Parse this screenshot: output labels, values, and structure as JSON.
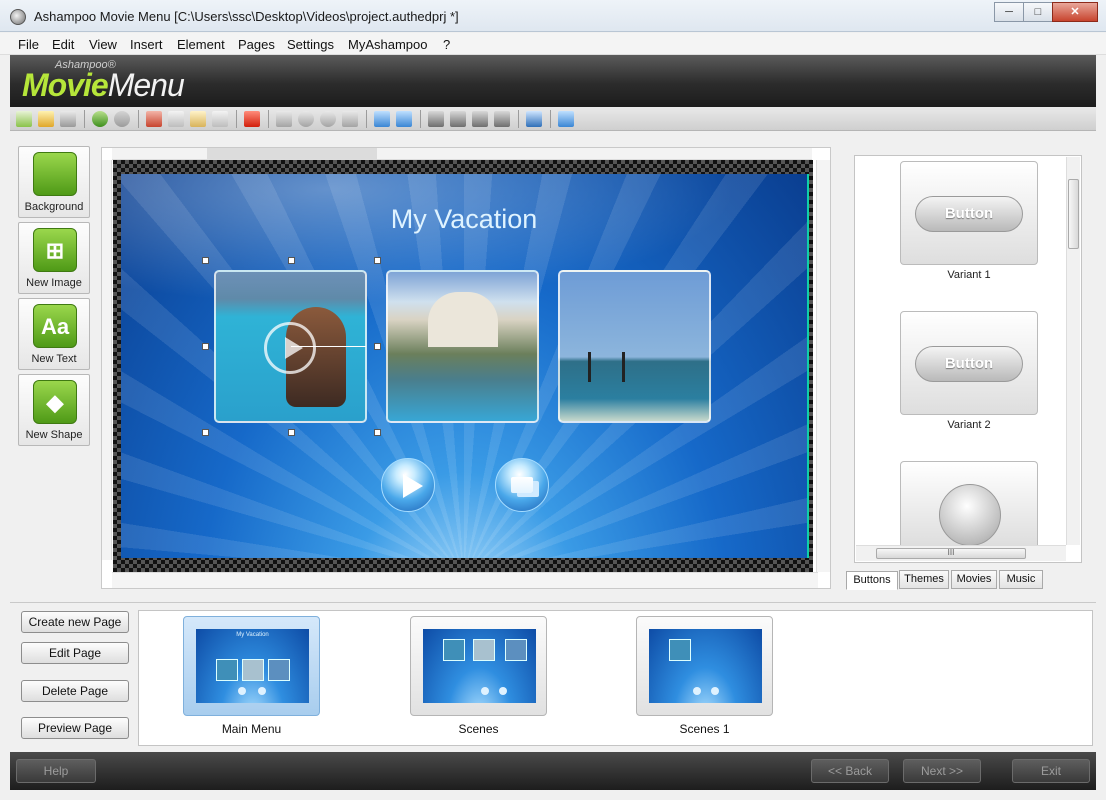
{
  "window": {
    "title": "Ashampoo Movie Menu [C:\\Users\\ssc\\Desktop\\Videos\\project.authedprj *]",
    "controls": {
      "minimize": "─",
      "maximize": "□",
      "close": "✕"
    }
  },
  "menubar": [
    "File",
    "Edit",
    "View",
    "Insert",
    "Element",
    "Pages",
    "Settings",
    "MyAshampoo",
    "?"
  ],
  "brand": {
    "small": "Ashampoo®",
    "movie": "Movie",
    "menu": "Menu"
  },
  "toolbar": {
    "icons": [
      "new-icon",
      "open-icon",
      "save-icon",
      "undo-icon",
      "redo-icon",
      "cut-icon",
      "copy-icon",
      "paste-icon",
      "paste-special-icon",
      "delete-icon",
      "zoom-fit-icon",
      "zoom-in-icon",
      "zoom-out-icon",
      "zoom-actual-icon",
      "bring-front-icon",
      "send-back-icon",
      "flip-horizontal-icon",
      "flip-vertical-icon",
      "align-center-vertical-icon",
      "align-center-horizontal-icon",
      "properties-icon",
      "preview-icon"
    ]
  },
  "palette": {
    "items": [
      {
        "label": "Background",
        "icon": "background-icon"
      },
      {
        "label": "New Image",
        "icon": "image-icon"
      },
      {
        "label": "New Text",
        "icon": "text-icon",
        "glyph": "Aa"
      },
      {
        "label": "New Shape",
        "icon": "shape-icon"
      }
    ]
  },
  "canvas": {
    "menu_title": "My Vacation",
    "accent": "#1669c9"
  },
  "gallery": {
    "variants": [
      {
        "label": "Variant 1",
        "button_text": "Button"
      },
      {
        "label": "Variant 2",
        "button_text": "Button"
      },
      {
        "label": ""
      }
    ],
    "hscroll_grip": "III"
  },
  "tabs": [
    "Buttons",
    "Themes",
    "Movies",
    "Music"
  ],
  "page_actions": [
    "Create new Page",
    "Edit Page",
    "Delete Page",
    "Preview Page"
  ],
  "pages": [
    {
      "label": "Main Menu",
      "mini_title": "My Vacation"
    },
    {
      "label": "Scenes"
    },
    {
      "label": "Scenes 1"
    }
  ],
  "footer": {
    "help": "Help",
    "back": "<< Back",
    "next": "Next >>",
    "exit": "Exit"
  }
}
